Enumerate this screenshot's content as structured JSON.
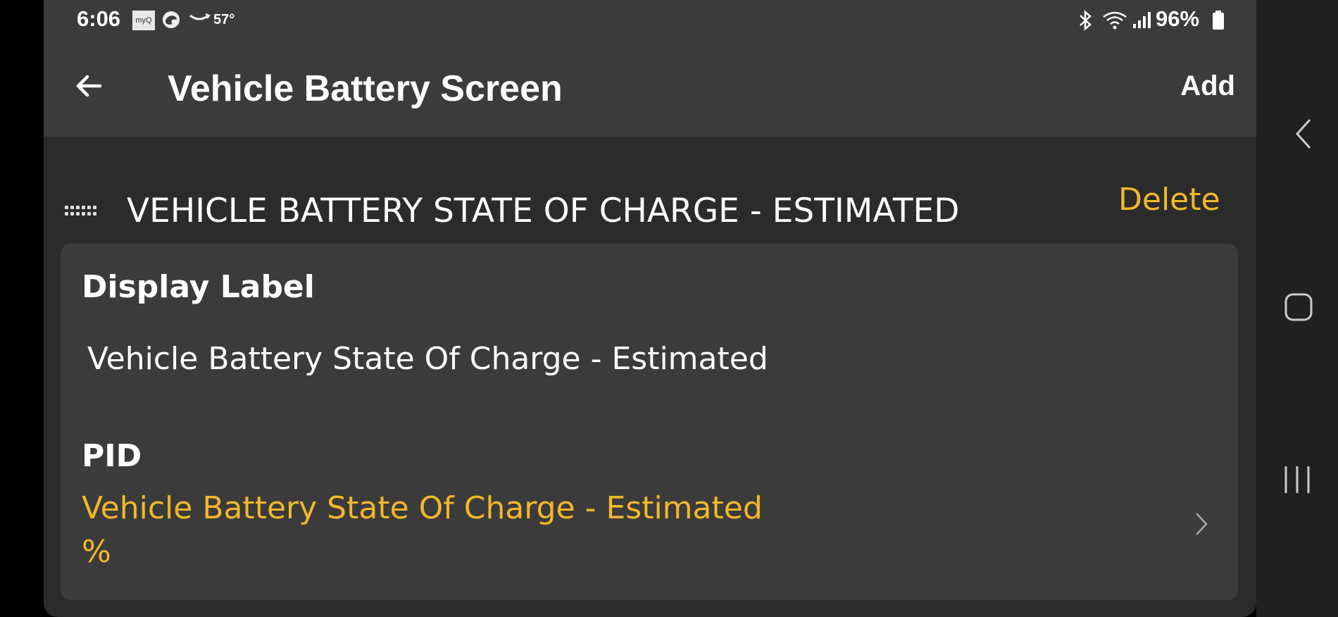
{
  "status_bar": {
    "time": "6:06",
    "myq_text": "myQ",
    "temperature": "57°",
    "battery_percent": "96%",
    "icons": [
      "myq-icon",
      "edge-icon",
      "amazon-icon",
      "bluetooth-icon",
      "wifi-icon",
      "signal-icon",
      "battery-icon"
    ]
  },
  "header": {
    "title": "Vehicle Battery Screen",
    "add_label": "Add"
  },
  "section": {
    "title": "VEHICLE BATTERY STATE OF CHARGE - ESTIMATED",
    "delete_label": "Delete"
  },
  "card": {
    "display_label_heading": "Display Label",
    "display_label_value": "Vehicle Battery State Of Charge - Estimated",
    "pid_heading": "PID",
    "pid_name": "Vehicle Battery State Of Charge - Estimated",
    "pid_unit": "%"
  },
  "colors": {
    "background": "#2b2b2b",
    "surface": "#3b3b3b",
    "accent": "#f2b82a",
    "text": "#ffffff"
  }
}
